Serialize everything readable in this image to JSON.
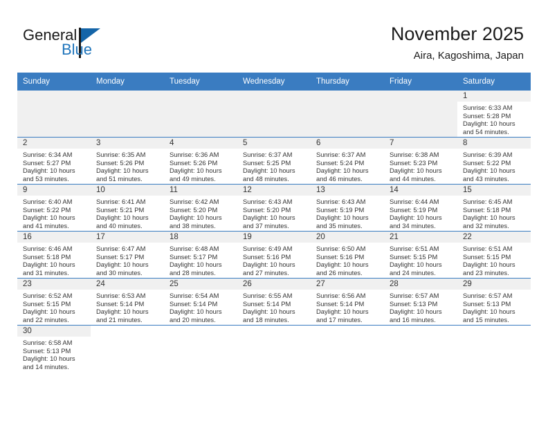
{
  "brand": {
    "name_part1": "General",
    "name_part2": "Blue",
    "flag_color": "#1565a8",
    "blue_color": "#1e74bb"
  },
  "header": {
    "title": "November 2025",
    "subtitle": "Aira, Kagoshima, Japan"
  },
  "theme": {
    "header_bg": "#3a7cc1",
    "header_text": "#ffffff",
    "daynum_band_bg": "#f0f0f0",
    "grid_line": "#3a7cc1",
    "body_text": "#333333"
  },
  "weekday_headers": [
    "Sunday",
    "Monday",
    "Tuesday",
    "Wednesday",
    "Thursday",
    "Friday",
    "Saturday"
  ],
  "weeks": [
    [
      {
        "day": "",
        "sunrise": "",
        "sunset": "",
        "daylight1": "",
        "daylight2": "",
        "empty": true
      },
      {
        "day": "",
        "sunrise": "",
        "sunset": "",
        "daylight1": "",
        "daylight2": "",
        "empty": true
      },
      {
        "day": "",
        "sunrise": "",
        "sunset": "",
        "daylight1": "",
        "daylight2": "",
        "empty": true
      },
      {
        "day": "",
        "sunrise": "",
        "sunset": "",
        "daylight1": "",
        "daylight2": "",
        "empty": true
      },
      {
        "day": "",
        "sunrise": "",
        "sunset": "",
        "daylight1": "",
        "daylight2": "",
        "empty": true
      },
      {
        "day": "",
        "sunrise": "",
        "sunset": "",
        "daylight1": "",
        "daylight2": "",
        "empty": true
      },
      {
        "day": "1",
        "sunrise": "Sunrise: 6:33 AM",
        "sunset": "Sunset: 5:28 PM",
        "daylight1": "Daylight: 10 hours",
        "daylight2": "and 54 minutes.",
        "empty": false
      }
    ],
    [
      {
        "day": "2",
        "sunrise": "Sunrise: 6:34 AM",
        "sunset": "Sunset: 5:27 PM",
        "daylight1": "Daylight: 10 hours",
        "daylight2": "and 53 minutes.",
        "empty": false
      },
      {
        "day": "3",
        "sunrise": "Sunrise: 6:35 AM",
        "sunset": "Sunset: 5:26 PM",
        "daylight1": "Daylight: 10 hours",
        "daylight2": "and 51 minutes.",
        "empty": false
      },
      {
        "day": "4",
        "sunrise": "Sunrise: 6:36 AM",
        "sunset": "Sunset: 5:26 PM",
        "daylight1": "Daylight: 10 hours",
        "daylight2": "and 49 minutes.",
        "empty": false
      },
      {
        "day": "5",
        "sunrise": "Sunrise: 6:37 AM",
        "sunset": "Sunset: 5:25 PM",
        "daylight1": "Daylight: 10 hours",
        "daylight2": "and 48 minutes.",
        "empty": false
      },
      {
        "day": "6",
        "sunrise": "Sunrise: 6:37 AM",
        "sunset": "Sunset: 5:24 PM",
        "daylight1": "Daylight: 10 hours",
        "daylight2": "and 46 minutes.",
        "empty": false
      },
      {
        "day": "7",
        "sunrise": "Sunrise: 6:38 AM",
        "sunset": "Sunset: 5:23 PM",
        "daylight1": "Daylight: 10 hours",
        "daylight2": "and 44 minutes.",
        "empty": false
      },
      {
        "day": "8",
        "sunrise": "Sunrise: 6:39 AM",
        "sunset": "Sunset: 5:22 PM",
        "daylight1": "Daylight: 10 hours",
        "daylight2": "and 43 minutes.",
        "empty": false
      }
    ],
    [
      {
        "day": "9",
        "sunrise": "Sunrise: 6:40 AM",
        "sunset": "Sunset: 5:22 PM",
        "daylight1": "Daylight: 10 hours",
        "daylight2": "and 41 minutes.",
        "empty": false
      },
      {
        "day": "10",
        "sunrise": "Sunrise: 6:41 AM",
        "sunset": "Sunset: 5:21 PM",
        "daylight1": "Daylight: 10 hours",
        "daylight2": "and 40 minutes.",
        "empty": false
      },
      {
        "day": "11",
        "sunrise": "Sunrise: 6:42 AM",
        "sunset": "Sunset: 5:20 PM",
        "daylight1": "Daylight: 10 hours",
        "daylight2": "and 38 minutes.",
        "empty": false
      },
      {
        "day": "12",
        "sunrise": "Sunrise: 6:43 AM",
        "sunset": "Sunset: 5:20 PM",
        "daylight1": "Daylight: 10 hours",
        "daylight2": "and 37 minutes.",
        "empty": false
      },
      {
        "day": "13",
        "sunrise": "Sunrise: 6:43 AM",
        "sunset": "Sunset: 5:19 PM",
        "daylight1": "Daylight: 10 hours",
        "daylight2": "and 35 minutes.",
        "empty": false
      },
      {
        "day": "14",
        "sunrise": "Sunrise: 6:44 AM",
        "sunset": "Sunset: 5:19 PM",
        "daylight1": "Daylight: 10 hours",
        "daylight2": "and 34 minutes.",
        "empty": false
      },
      {
        "day": "15",
        "sunrise": "Sunrise: 6:45 AM",
        "sunset": "Sunset: 5:18 PM",
        "daylight1": "Daylight: 10 hours",
        "daylight2": "and 32 minutes.",
        "empty": false
      }
    ],
    [
      {
        "day": "16",
        "sunrise": "Sunrise: 6:46 AM",
        "sunset": "Sunset: 5:18 PM",
        "daylight1": "Daylight: 10 hours",
        "daylight2": "and 31 minutes.",
        "empty": false
      },
      {
        "day": "17",
        "sunrise": "Sunrise: 6:47 AM",
        "sunset": "Sunset: 5:17 PM",
        "daylight1": "Daylight: 10 hours",
        "daylight2": "and 30 minutes.",
        "empty": false
      },
      {
        "day": "18",
        "sunrise": "Sunrise: 6:48 AM",
        "sunset": "Sunset: 5:17 PM",
        "daylight1": "Daylight: 10 hours",
        "daylight2": "and 28 minutes.",
        "empty": false
      },
      {
        "day": "19",
        "sunrise": "Sunrise: 6:49 AM",
        "sunset": "Sunset: 5:16 PM",
        "daylight1": "Daylight: 10 hours",
        "daylight2": "and 27 minutes.",
        "empty": false
      },
      {
        "day": "20",
        "sunrise": "Sunrise: 6:50 AM",
        "sunset": "Sunset: 5:16 PM",
        "daylight1": "Daylight: 10 hours",
        "daylight2": "and 26 minutes.",
        "empty": false
      },
      {
        "day": "21",
        "sunrise": "Sunrise: 6:51 AM",
        "sunset": "Sunset: 5:15 PM",
        "daylight1": "Daylight: 10 hours",
        "daylight2": "and 24 minutes.",
        "empty": false
      },
      {
        "day": "22",
        "sunrise": "Sunrise: 6:51 AM",
        "sunset": "Sunset: 5:15 PM",
        "daylight1": "Daylight: 10 hours",
        "daylight2": "and 23 minutes.",
        "empty": false
      }
    ],
    [
      {
        "day": "23",
        "sunrise": "Sunrise: 6:52 AM",
        "sunset": "Sunset: 5:15 PM",
        "daylight1": "Daylight: 10 hours",
        "daylight2": "and 22 minutes.",
        "empty": false
      },
      {
        "day": "24",
        "sunrise": "Sunrise: 6:53 AM",
        "sunset": "Sunset: 5:14 PM",
        "daylight1": "Daylight: 10 hours",
        "daylight2": "and 21 minutes.",
        "empty": false
      },
      {
        "day": "25",
        "sunrise": "Sunrise: 6:54 AM",
        "sunset": "Sunset: 5:14 PM",
        "daylight1": "Daylight: 10 hours",
        "daylight2": "and 20 minutes.",
        "empty": false
      },
      {
        "day": "26",
        "sunrise": "Sunrise: 6:55 AM",
        "sunset": "Sunset: 5:14 PM",
        "daylight1": "Daylight: 10 hours",
        "daylight2": "and 18 minutes.",
        "empty": false
      },
      {
        "day": "27",
        "sunrise": "Sunrise: 6:56 AM",
        "sunset": "Sunset: 5:14 PM",
        "daylight1": "Daylight: 10 hours",
        "daylight2": "and 17 minutes.",
        "empty": false
      },
      {
        "day": "28",
        "sunrise": "Sunrise: 6:57 AM",
        "sunset": "Sunset: 5:13 PM",
        "daylight1": "Daylight: 10 hours",
        "daylight2": "and 16 minutes.",
        "empty": false
      },
      {
        "day": "29",
        "sunrise": "Sunrise: 6:57 AM",
        "sunset": "Sunset: 5:13 PM",
        "daylight1": "Daylight: 10 hours",
        "daylight2": "and 15 minutes.",
        "empty": false
      }
    ],
    [
      {
        "day": "30",
        "sunrise": "Sunrise: 6:58 AM",
        "sunset": "Sunset: 5:13 PM",
        "daylight1": "Daylight: 10 hours",
        "daylight2": "and 14 minutes.",
        "empty": false
      },
      {
        "day": "",
        "sunrise": "",
        "sunset": "",
        "daylight1": "",
        "daylight2": "",
        "blank": true
      },
      {
        "day": "",
        "sunrise": "",
        "sunset": "",
        "daylight1": "",
        "daylight2": "",
        "blank": true
      },
      {
        "day": "",
        "sunrise": "",
        "sunset": "",
        "daylight1": "",
        "daylight2": "",
        "blank": true
      },
      {
        "day": "",
        "sunrise": "",
        "sunset": "",
        "daylight1": "",
        "daylight2": "",
        "blank": true
      },
      {
        "day": "",
        "sunrise": "",
        "sunset": "",
        "daylight1": "",
        "daylight2": "",
        "blank": true
      },
      {
        "day": "",
        "sunrise": "",
        "sunset": "",
        "daylight1": "",
        "daylight2": "",
        "blank": true
      }
    ]
  ]
}
